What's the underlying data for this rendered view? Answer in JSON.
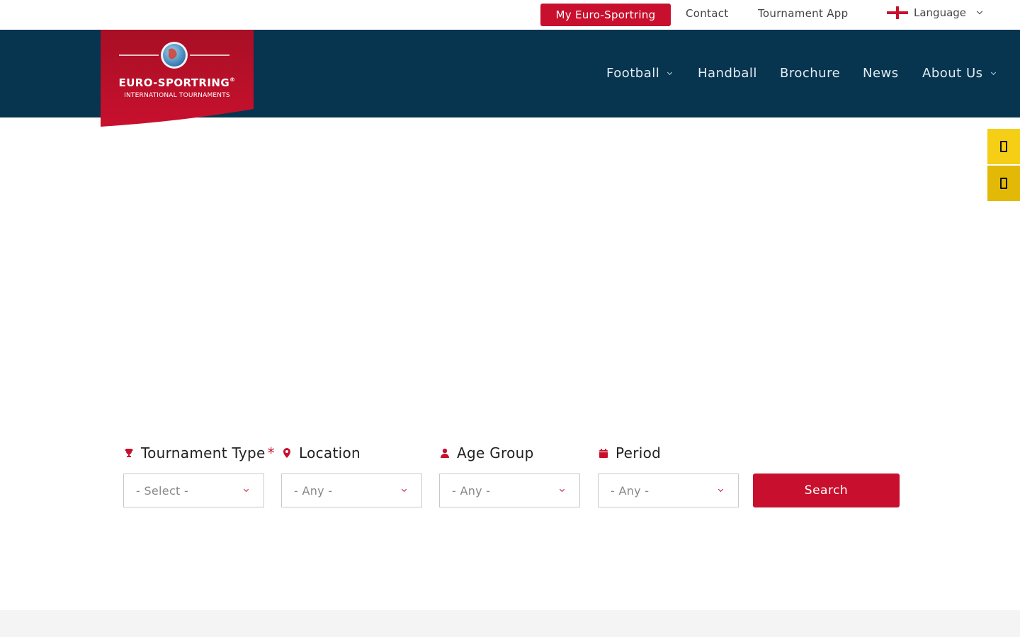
{
  "topbar": {
    "my_account": "My Euro-Sportring",
    "contact": "Contact",
    "tournament_app": "Tournament App",
    "language": "Language"
  },
  "logo": {
    "brand": "EURO-SPORTRING",
    "registered": "®",
    "tagline": "INTERNATIONAL TOURNAMENTS"
  },
  "nav": {
    "items": [
      {
        "label": "Football",
        "has_dropdown": true
      },
      {
        "label": "Handball",
        "has_dropdown": false
      },
      {
        "label": "Brochure",
        "has_dropdown": false
      },
      {
        "label": "News",
        "has_dropdown": false
      },
      {
        "label": "About Us",
        "has_dropdown": true
      }
    ]
  },
  "side_buttons": [
    {
      "icon": "phone-icon",
      "color": "#f5ce16"
    },
    {
      "icon": "mobile-icon",
      "color": "#e3b908"
    }
  ],
  "search": {
    "fields": [
      {
        "label": "Tournament Type",
        "required_mark": "*",
        "icon": "trophy-icon",
        "value": "- Select -"
      },
      {
        "label": "Location",
        "icon": "map-pin-icon",
        "value": "- Any -"
      },
      {
        "label": "Age Group",
        "icon": "user-icon",
        "value": "- Any -"
      },
      {
        "label": "Period",
        "icon": "calendar-icon",
        "value": "- Any -"
      }
    ],
    "button": "Search"
  },
  "colors": {
    "brand_red": "#c8102e",
    "navy": "#07344f",
    "yellow": "#f5ce16"
  }
}
